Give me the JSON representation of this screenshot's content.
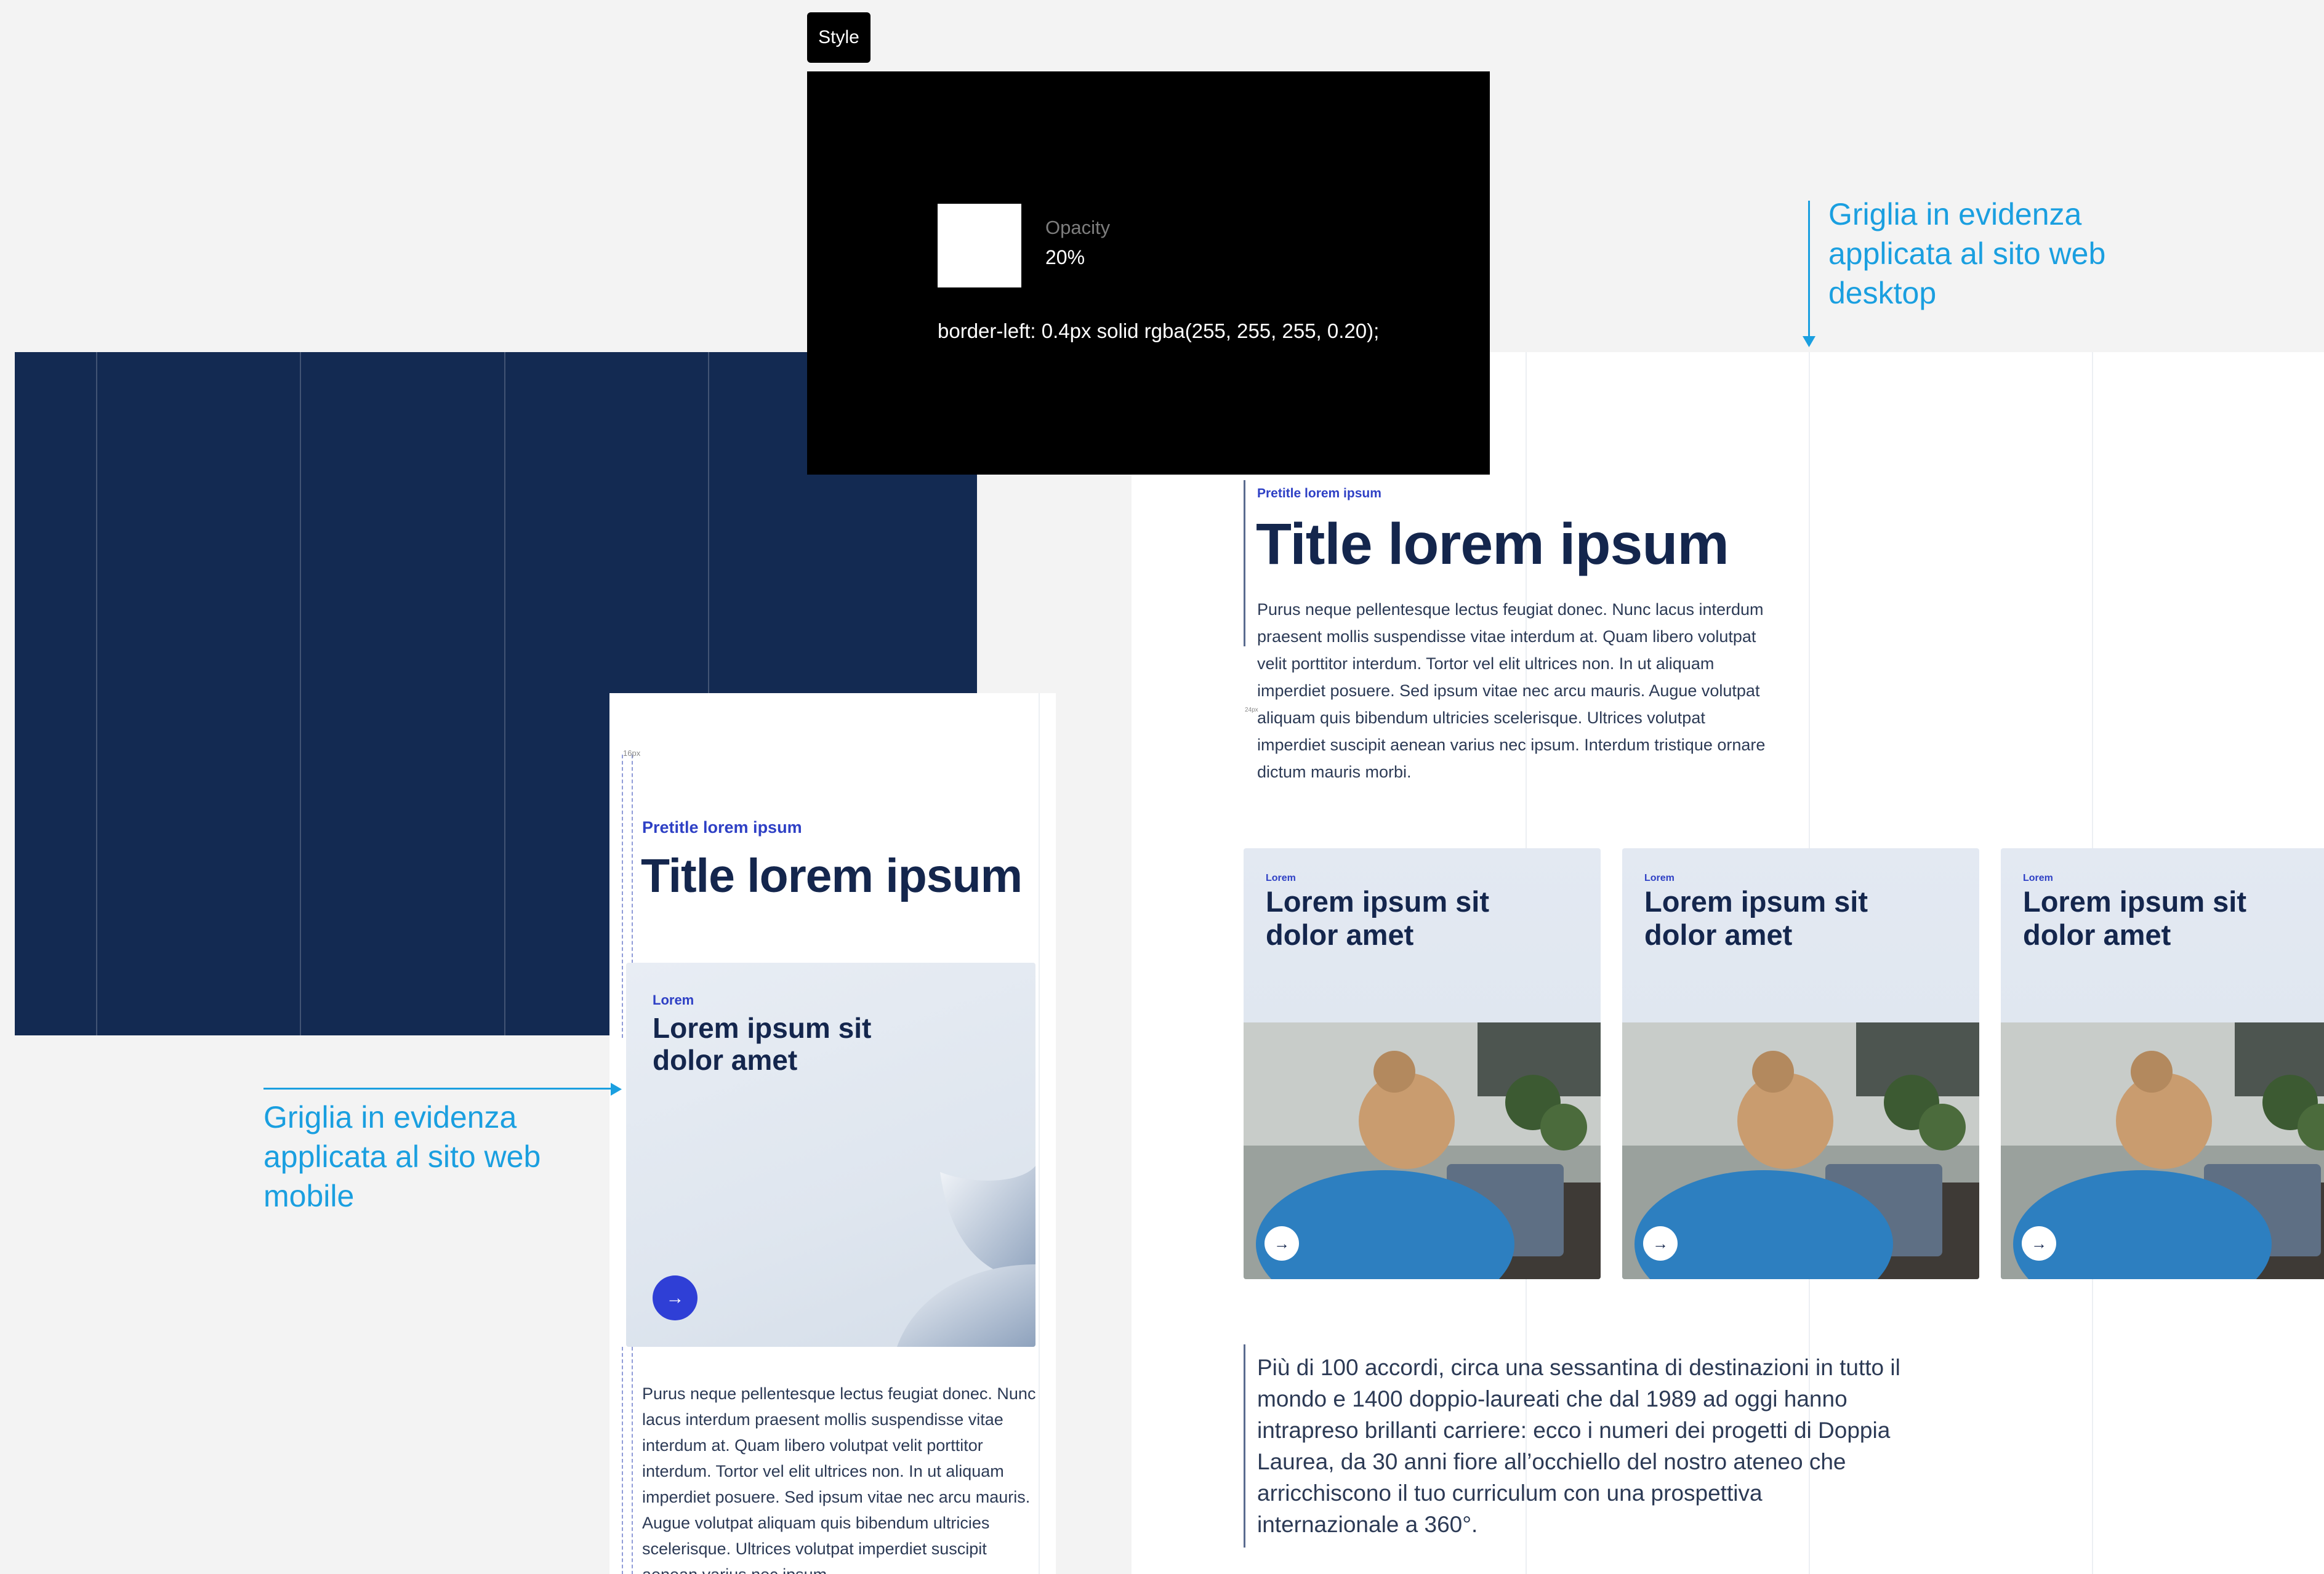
{
  "style_panel": {
    "tag_label": "Style",
    "opacity_label": "Opacity",
    "opacity_value": "20%",
    "css": "border-left: 0.4px solid rgba(255, 255, 255, 0.20);",
    "swatch_color": "#ffffff"
  },
  "annotations": {
    "desktop": [
      "Griglia in evidenza",
      "applicata al sito web",
      "desktop"
    ],
    "mobile": [
      "Griglia in evidenza",
      "applicata al sito web",
      "mobile"
    ],
    "color": "#1a9fe0"
  },
  "colors": {
    "grid_dark": "#132a52",
    "accent_blue": "#2f3fd6",
    "title_navy": "#14264d",
    "canvas": "#f3f3f3"
  },
  "desktop": {
    "pretitle": "Pretitle lorem ipsum",
    "title": "Title lorem ipsum",
    "body": "Purus neque pellentesque lectus feugiat donec. Nunc lacus interdum praesent mollis suspendisse vitae interdum at. Quam libero volutpat velit porttitor interdum. Tortor vel elit ultrices non. In ut aliquam imperdiet posuere. Sed ipsum vitae nec arcu mauris. Augue volutpat aliquam quis bibendum ultricies scelerisque. Ultrices volutpat imperdiet suscipit aenean varius nec ipsum. Interdum tristique ornare dictum mauris morbi.",
    "cards": [
      {
        "pretitle": "Lorem",
        "title": "Lorem ipsum sit dolor amet",
        "arrow": "→",
        "image": "woman-at-laptop-photo"
      },
      {
        "pretitle": "Lorem",
        "title": "Lorem ipsum sit dolor amet",
        "arrow": "→",
        "image": "woman-at-laptop-photo"
      },
      {
        "pretitle": "Lorem",
        "title": "Lorem ipsum sit dolor amet",
        "arrow": "→",
        "image": "woman-at-laptop-photo"
      }
    ],
    "spacing_label": "24px",
    "bottom_text": "Più di 100 accordi, circa una sessantina di destinazioni in tutto il mondo e 1400 doppio-laureati che dal 1989 ad oggi hanno intrapreso brillanti carriere: ecco i numeri dei progetti di Doppia Laurea, da 30 anni fiore all’occhiello del nostro ateneo che arricchiscono il tuo curriculum con una prospettiva internazionale a 360°."
  },
  "mobile": {
    "spacing_label": "16px",
    "pretitle": "Pretitle lorem ipsum",
    "title": "Title lorem ipsum",
    "card": {
      "pretitle": "Lorem",
      "title": "Lorem ipsum sit dolor amet",
      "arrow": "→"
    },
    "body": "Purus neque pellentesque lectus feugiat donec. Nunc lacus interdum praesent mollis suspendisse vitae interdum at. Quam libero volutpat velit porttitor interdum. Tortor vel elit ultrices non. In ut aliquam imperdiet posuere. Sed ipsum vitae nec arcu mauris. Augue volutpat aliquam quis bibendum ultricies scelerisque. Ultrices volutpat imperdiet suscipit aenean varius nec ipsum."
  }
}
